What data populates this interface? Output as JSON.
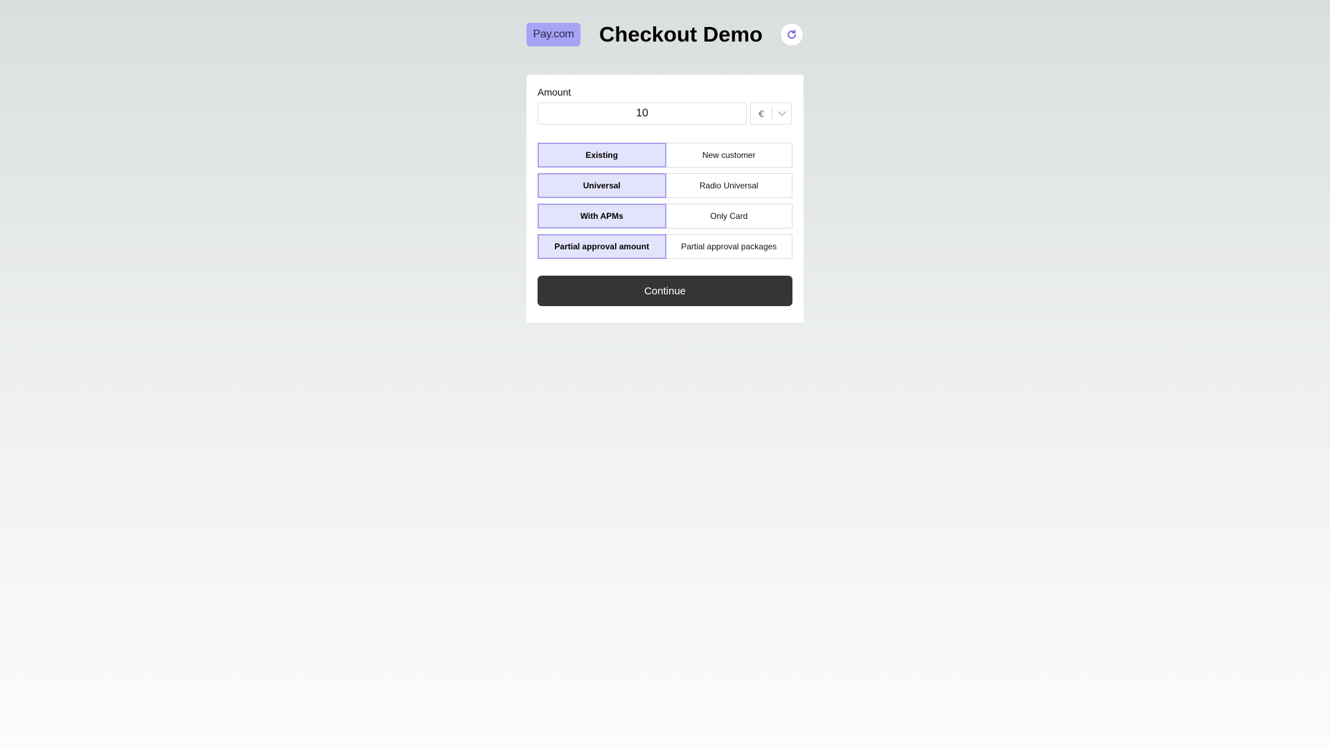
{
  "header": {
    "logo_text": "Pay.com",
    "title": "Checkout Demo",
    "refresh_icon": "refresh-icon"
  },
  "form": {
    "amount_label": "Amount",
    "amount_value": "10",
    "currency_symbol": "€",
    "currency_icon": "chevron-down-icon",
    "toggles": [
      {
        "selected": "Existing",
        "other": "New customer"
      },
      {
        "selected": "Universal",
        "other": "Radio Universal"
      },
      {
        "selected": "With APMs",
        "other": "Only Card"
      },
      {
        "selected": "Partial approval amount",
        "other": "Partial approval packages"
      }
    ],
    "continue_label": "Continue"
  },
  "colors": {
    "accent": "#a9a5ee",
    "accent_bg": "#e4e3fc",
    "logo_bg": "#a8a4f5",
    "button_bg": "#353535",
    "refresh_icon_color": "#6b64e0"
  }
}
